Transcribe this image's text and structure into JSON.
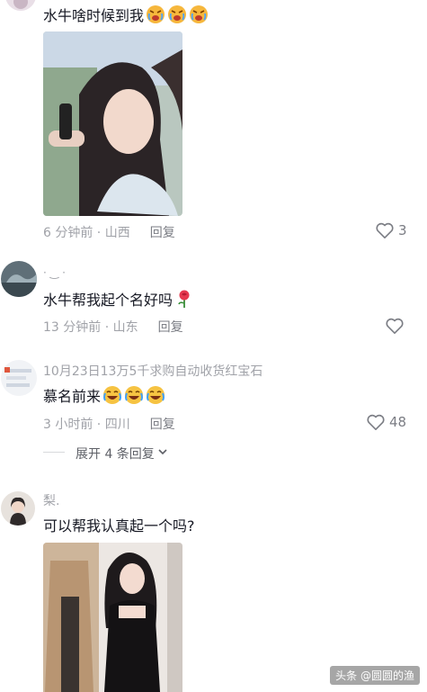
{
  "comments": [
    {
      "content": "水牛啥时候到我",
      "emoji_count": 3,
      "emoji_icon": "angry-crying-emoji",
      "time_location": "6 分钟前 · 山西",
      "reply_label": "回复",
      "likes": "3"
    },
    {
      "username": "· ‿ ·",
      "content": "水牛帮我起个名好吗",
      "emoji_icon": "rose-emoji",
      "time_location": "13 分钟前 · 山东",
      "reply_label": "回复",
      "likes": ""
    },
    {
      "username": "10月23日13万5千求购自动收货红宝石",
      "content": "慕名前来",
      "emoji_count": 3,
      "emoji_icon": "laughing-crying-emoji",
      "time_location": "3 小时前 · 四川",
      "reply_label": "回复",
      "likes": "48",
      "expand_label": "展开 4 条回复"
    },
    {
      "username": "梨.",
      "content": "可以帮我认真起一个吗?"
    }
  ],
  "watermark": "头条 @圆圆的渔",
  "colors": {
    "meta_text": "#a0a2a8",
    "body_text": "#161823",
    "heart_outline": "#7b7d84"
  }
}
